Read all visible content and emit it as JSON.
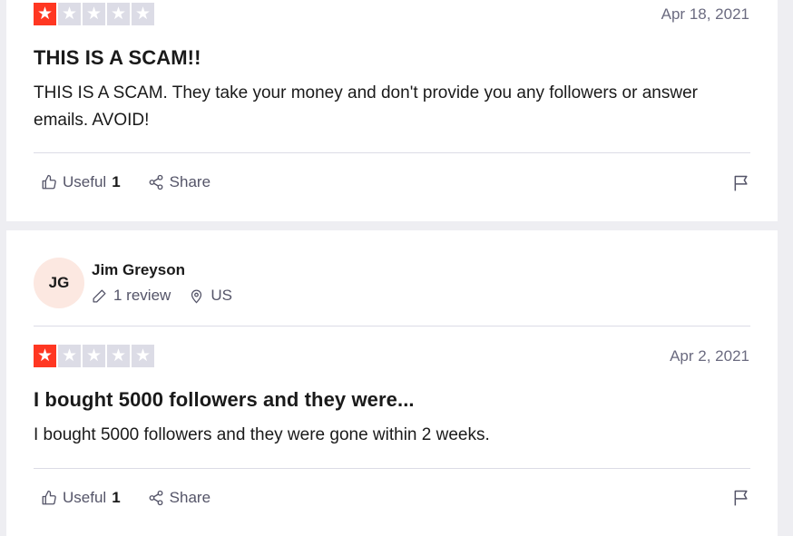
{
  "reviews": [
    {
      "rating": 1,
      "date": "Apr 18, 2021",
      "title": "THIS IS A SCAM!!",
      "body": "THIS IS A SCAM. They take your money and don't provide you any followers or answer emails. AVOID!",
      "useful_label": "Useful",
      "useful_count": "1",
      "share_label": "Share"
    },
    {
      "reviewer": {
        "initials": "JG",
        "name": "Jim Greyson",
        "review_count": "1 review",
        "country": "US"
      },
      "rating": 1,
      "date": "Apr 2, 2021",
      "title": "I bought 5000 followers and they were...",
      "body": "I bought 5000 followers and they were gone within 2 weeks.",
      "useful_label": "Useful",
      "useful_count": "1",
      "share_label": "Share"
    }
  ],
  "colors": {
    "star_filled": "#ff3722",
    "star_empty": "#dcdce6",
    "avatar_bg": "#fce8e1"
  },
  "icons": [
    "star-icon",
    "thumbs-up-icon",
    "share-icon",
    "flag-icon",
    "pencil-icon",
    "location-pin-icon"
  ]
}
